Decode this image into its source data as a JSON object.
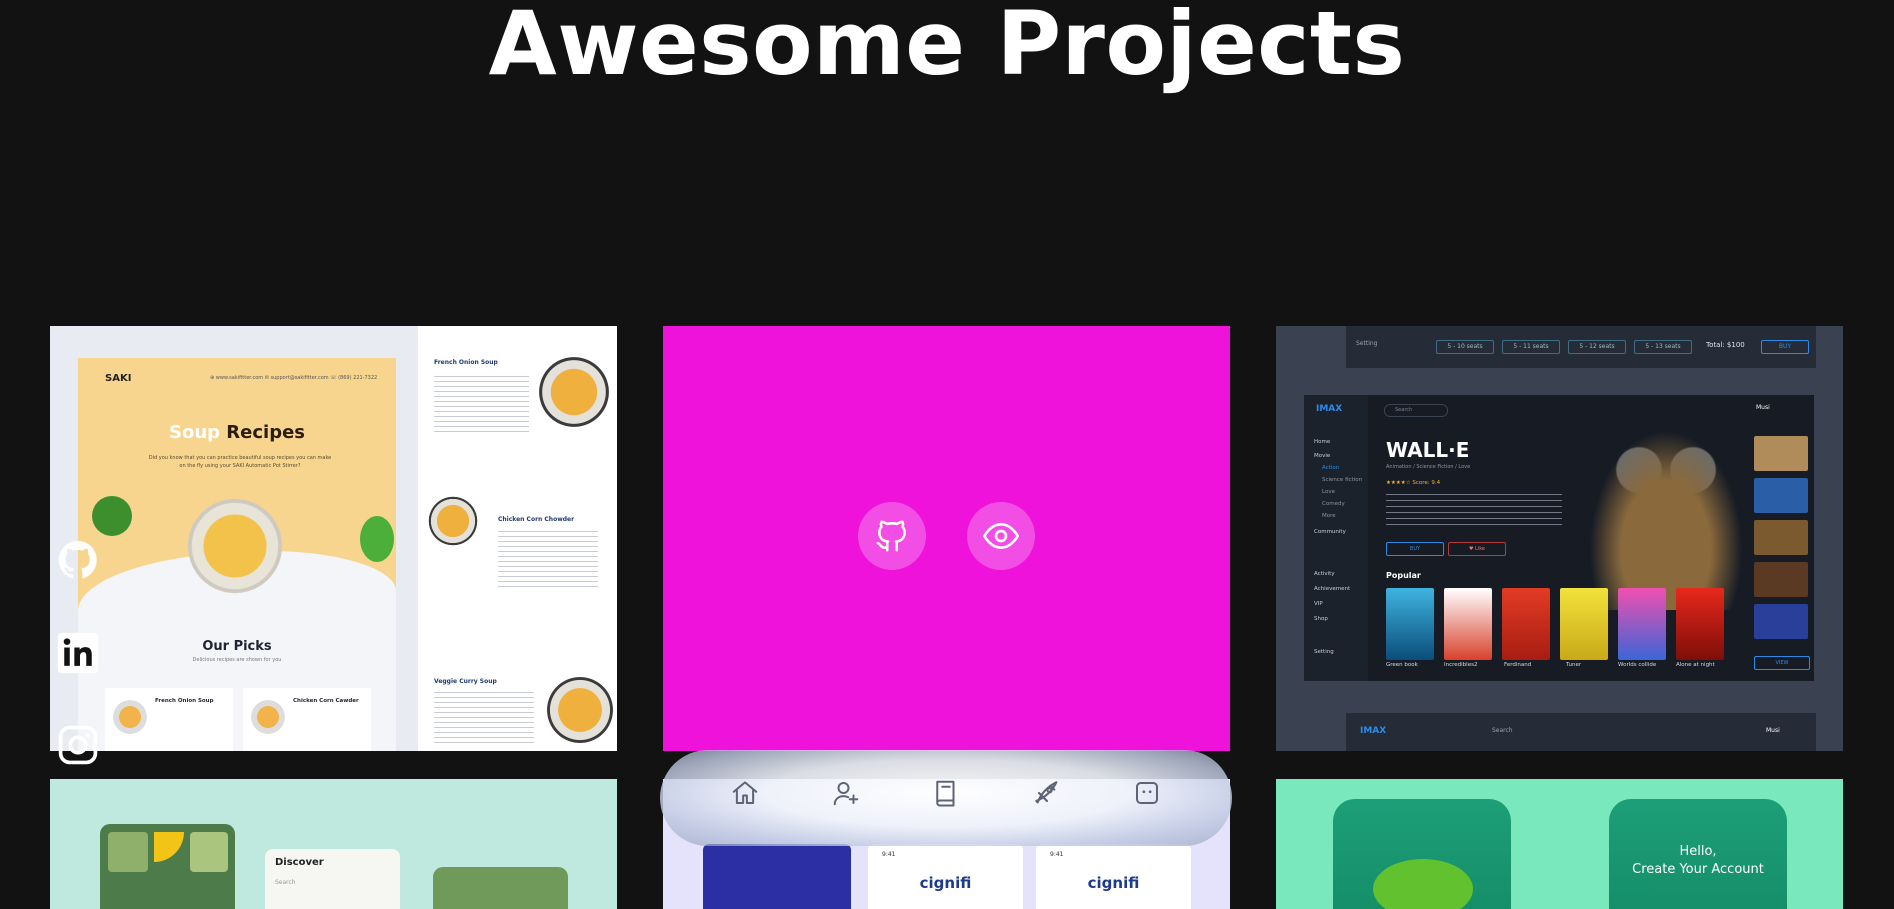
{
  "page": {
    "title": "Awesome Projects"
  },
  "colors": {
    "background": "#121212",
    "highlight": "#ee12db",
    "nav_glass": "#e8ecf6"
  },
  "social": [
    {
      "name": "github",
      "icon": "github-icon"
    },
    {
      "name": "linkedin",
      "icon": "linkedin-icon"
    },
    {
      "name": "instagram",
      "icon": "instagram-icon"
    }
  ],
  "card_hover": {
    "actions": [
      {
        "icon": "github-icon"
      },
      {
        "icon": "eye-icon"
      }
    ]
  },
  "nav": [
    {
      "icon": "home-icon"
    },
    {
      "icon": "user-plus-icon"
    },
    {
      "icon": "book-icon"
    },
    {
      "icon": "rocket-icon"
    },
    {
      "icon": "chat-icon"
    }
  ],
  "projects": {
    "soup": {
      "logo": "SAKI",
      "contacts": "⊕ www.sakifitter.com   ✉ support@sakifitter.com   ☏ (869) 221-7322",
      "heading_accent": "Soup",
      "heading": "Recipes",
      "subtitle": "Did you know that you can practice beautiful soup recipes you can make on the fly using your SAKI Automatic Pot Stirrer?",
      "picks_title": "Our Picks",
      "picks_subtitle": "Delicious recipes are shown for you",
      "picks": [
        {
          "name": "French Onion Soup"
        },
        {
          "name": "Chicken Corn Cawder"
        }
      ],
      "recipes": [
        {
          "title": "French Onion Soup"
        },
        {
          "title": "Chicken Corn Chowder"
        },
        {
          "title": "Veggie Curry Soup"
        }
      ]
    },
    "imax": {
      "setting_label": "Setting",
      "seats": [
        "5 - 10 seats",
        "5 - 11 seats",
        "5 - 12 seats",
        "5 - 13 seats"
      ],
      "total": "Total: $100",
      "buy_label": "BUY",
      "logo": "IMAX",
      "search_placeholder": "Search",
      "user": "Musi",
      "sidebar": [
        "Home",
        "Movie",
        "Action",
        "Science fiction",
        "Love",
        "Comedy",
        "More",
        "Community",
        "Activity",
        "Achievement",
        "VIP",
        "Shop",
        "Setting"
      ],
      "title": "WALL·E",
      "genre": "Animation / Science Fiction / Love",
      "rating": "★★★★☆  Score: 9.4",
      "like_label": "♥ Like",
      "popular_label": "Popular",
      "posters": [
        "Green book",
        "Incredibles2",
        "Ferdinand",
        "Tuner",
        "Worlds collide",
        "Alone at night"
      ],
      "view_label": "VIEW"
    },
    "garden": {
      "discover_title": "Discover",
      "search_placeholder": "Search"
    },
    "cignifi": {
      "brand": "cignifi",
      "time": "9:41"
    },
    "plants": {
      "greeting": "Hello,",
      "cta": "Create Your Account"
    }
  }
}
